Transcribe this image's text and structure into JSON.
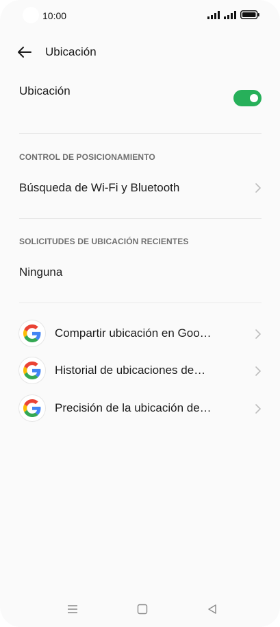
{
  "status_bar": {
    "time": "10:00"
  },
  "header": {
    "title": "Ubicación"
  },
  "location_toggle": {
    "label": "Ubicación",
    "state": "on",
    "color": "#27b05a"
  },
  "sections": {
    "positioning_control": {
      "title": "CONTROL DE POSICIONAMIENTO",
      "item_label": "Búsqueda de Wi-Fi y Bluetooth"
    },
    "recent_requests": {
      "title": "SOLICITUDES DE UBICACIÓN RECIENTES",
      "item_label": "Ninguna"
    }
  },
  "google_items": [
    {
      "label": "Compartir ubicación en Goo…",
      "icon": "google-g-icon"
    },
    {
      "label": "Historial de ubicaciones de…",
      "icon": "google-g-icon"
    },
    {
      "label": "Precisión de la ubicación de…",
      "icon": "google-g-icon"
    }
  ],
  "nav_bar": {
    "icons": [
      "menu-icon",
      "home-icon",
      "back-triangle-icon"
    ]
  }
}
